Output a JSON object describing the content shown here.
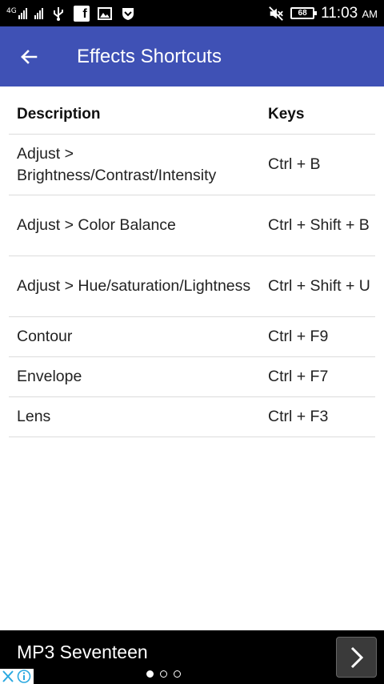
{
  "statusbar": {
    "network_label": "4G",
    "battery": "68",
    "time": "11:03",
    "ampm": "AM"
  },
  "appbar": {
    "title": "Effects Shortcuts"
  },
  "table": {
    "headers": {
      "description": "Description",
      "keys": "Keys"
    },
    "rows": [
      {
        "description": "Adjust > Brightness/Contrast/Intensity",
        "keys": "Ctrl + B"
      },
      {
        "description": "Adjust > Color Balance",
        "keys": "Ctrl + Shift + B"
      },
      {
        "description": "Adjust > Hue/saturation/Lightness",
        "keys": "Ctrl + Shift + U"
      },
      {
        "description": "Contour",
        "keys": "Ctrl + F9"
      },
      {
        "description": "Envelope",
        "keys": "Ctrl + F7"
      },
      {
        "description": "Lens",
        "keys": "Ctrl + F3"
      }
    ]
  },
  "ad": {
    "title": "MP3 Seventeen"
  },
  "icons": {
    "back": "arrow-back-icon",
    "next": "chevron-right-icon",
    "close": "close-icon",
    "info": "info-icon"
  }
}
